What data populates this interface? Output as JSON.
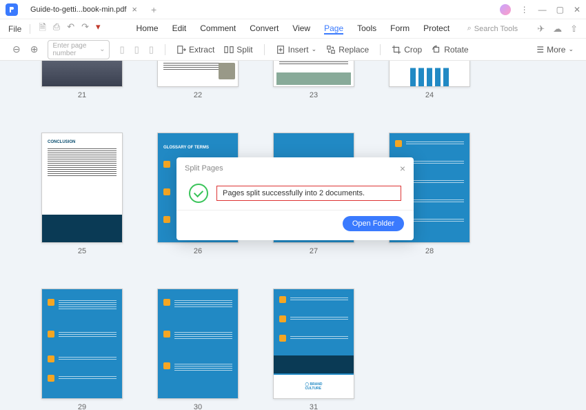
{
  "titlebar": {
    "filename": "Guide-to-getti...book-min.pdf"
  },
  "menu": {
    "file": "File",
    "items": [
      "Home",
      "Edit",
      "Comment",
      "Convert",
      "View",
      "Page",
      "Tools",
      "Form",
      "Protect"
    ],
    "active": "Page",
    "search": "Search Tools"
  },
  "toolbar": {
    "page_placeholder": "Enter page number",
    "extract": "Extract",
    "split": "Split",
    "insert": "Insert",
    "replace": "Replace",
    "crop": "Crop",
    "rotate": "Rotate",
    "more": "More"
  },
  "pages": [
    "21",
    "22",
    "23",
    "24",
    "25",
    "26",
    "27",
    "28",
    "29",
    "30",
    "31"
  ],
  "dialog": {
    "title": "Split Pages",
    "message": "Pages split successfully into 2 documents.",
    "button": "Open Folder"
  }
}
